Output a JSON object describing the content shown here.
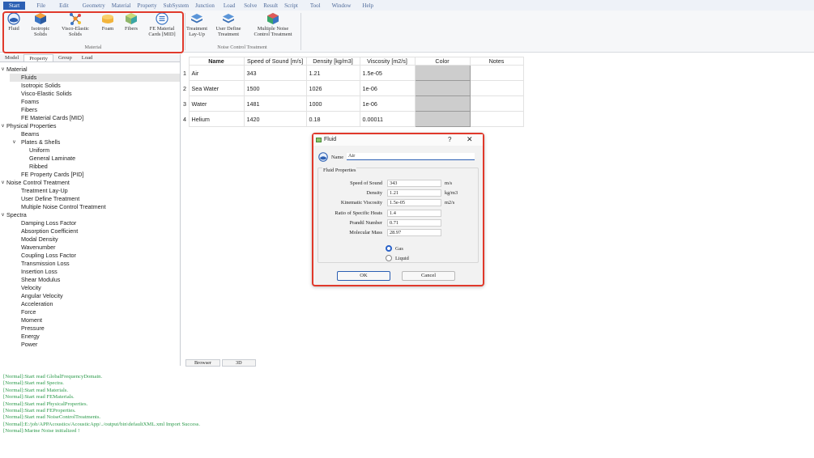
{
  "menu": [
    "Start",
    "File",
    "Edit",
    "Geometry",
    "Material",
    "Property",
    "SubSystem",
    "Junction",
    "Load",
    "Solve",
    "Result",
    "Script",
    "Tool",
    "Window",
    "Help"
  ],
  "ribbon": {
    "material_group": {
      "label": "Material",
      "buttons": [
        {
          "name": "fluid",
          "line1": "Fluid",
          "line2": ""
        },
        {
          "name": "isotropic",
          "line1": "Isotropic",
          "line2": "Solids"
        },
        {
          "name": "visco",
          "line1": "Visco-Elastic",
          "line2": "Solids"
        },
        {
          "name": "foam",
          "line1": "Foam",
          "line2": ""
        },
        {
          "name": "fibers",
          "line1": "Fibers",
          "line2": ""
        },
        {
          "name": "fe",
          "line1": "FE Material",
          "line2": "Cards [MID]"
        }
      ]
    },
    "noise_group": {
      "label": "Noise Control Treatment",
      "buttons": [
        {
          "name": "treatment",
          "line1": "Treatment",
          "line2": "Lay-Up"
        },
        {
          "name": "userdefine",
          "line1": "User Define",
          "line2": "Treatment"
        },
        {
          "name": "multiple",
          "line1": "Multiple Noise",
          "line2": "Control Treatment"
        }
      ]
    }
  },
  "left_tabs": [
    "Model",
    "Property",
    "Group",
    "Load"
  ],
  "tree": [
    {
      "text": "Material",
      "level": 0,
      "exp": "v"
    },
    {
      "text": "Fluids",
      "level": 1,
      "selected": true
    },
    {
      "text": "Isotropic Solids",
      "level": 1
    },
    {
      "text": "Visco-Elastic Solids",
      "level": 1
    },
    {
      "text": "Foams",
      "level": 1
    },
    {
      "text": "Fibers",
      "level": 1
    },
    {
      "text": "FE Material Cards [MID]",
      "level": 1
    },
    {
      "text": "Physical Properties",
      "level": 0,
      "exp": "v"
    },
    {
      "text": "Beams",
      "level": 1
    },
    {
      "text": "Plates & Shells",
      "level": 1,
      "exp": "v"
    },
    {
      "text": "Uniform",
      "level": 2
    },
    {
      "text": "General Laminate",
      "level": 2
    },
    {
      "text": "Ribbed",
      "level": 2
    },
    {
      "text": "FE Property Cards [PID]",
      "level": 1
    },
    {
      "text": "Noise Control Treatment",
      "level": 0,
      "exp": "v"
    },
    {
      "text": "Treatment Lay-Up",
      "level": 1
    },
    {
      "text": "User Define Treatment",
      "level": 1
    },
    {
      "text": "Multiple Noise Control Treatment",
      "level": 1
    },
    {
      "text": "Spectra",
      "level": 0,
      "exp": "v"
    },
    {
      "text": "Damping Loss Factor",
      "level": 1
    },
    {
      "text": "Absorption Coefficient",
      "level": 1
    },
    {
      "text": "Modal Density",
      "level": 1
    },
    {
      "text": "Wavenumber",
      "level": 1
    },
    {
      "text": "Coupling Loss Factor",
      "level": 1
    },
    {
      "text": "Transmission Loss",
      "level": 1
    },
    {
      "text": "Insertion Loss",
      "level": 1
    },
    {
      "text": "Shear Modulus",
      "level": 1
    },
    {
      "text": "Velocity",
      "level": 1
    },
    {
      "text": "Angular Velocity",
      "level": 1
    },
    {
      "text": "Acceleration",
      "level": 1
    },
    {
      "text": "Force",
      "level": 1
    },
    {
      "text": "Moment",
      "level": 1
    },
    {
      "text": "Pressure",
      "level": 1
    },
    {
      "text": "Energy",
      "level": 1
    },
    {
      "text": "Power",
      "level": 1
    }
  ],
  "table": {
    "headers": [
      "Name",
      "Speed of Sound [m/s]",
      "Density [kg/m3]",
      "Viscosity [m2/s]",
      "Color",
      "Notes"
    ],
    "rows": [
      {
        "num": "1",
        "name": "Air",
        "speed": "343",
        "density": "1.21",
        "viscosity": "1.5e-05"
      },
      {
        "num": "2",
        "name": "Sea Water",
        "speed": "1500",
        "density": "1026",
        "viscosity": "1e-06"
      },
      {
        "num": "3",
        "name": "Water",
        "speed": "1481",
        "density": "1000",
        "viscosity": "1e-06"
      },
      {
        "num": "4",
        "name": "Helium",
        "speed": "1420",
        "density": "0.18",
        "viscosity": "0.00011"
      }
    ]
  },
  "bottom_tabs": [
    "Browser",
    "3D"
  ],
  "log": [
    "[Normal]:Start read GlobalFrequencyDomain.",
    "[Normal]:Start read Spectra.",
    "[Normal]:Start read Materials.",
    "[Normal]:Start read FEMaterials.",
    "[Normal]:Start read PhysicalProperties.",
    "[Normal]:Start read FEProperties.",
    "[Normal]:Start read NoiseControlTreatments.",
    "[Normal]:E:/job/APPAcoustics/AcousticApp/../output/bin\\defaultXML.xml Import Success.",
    "[Normal]:Marine Noise initialized !"
  ],
  "dialog": {
    "title": "Fluid",
    "help": "?",
    "close": "✕",
    "name_label": "Name",
    "name_value": "Air",
    "group_title": "Fluid Properties",
    "fields": [
      {
        "label": "Speed of Sound",
        "value": "343",
        "unit": "m/s"
      },
      {
        "label": "Density",
        "value": "1.21",
        "unit": "kg/m3"
      },
      {
        "label": "Kinematic Viscosity",
        "value": "1.5e-05",
        "unit": "m2/s"
      },
      {
        "label": "Ratio of Specific Heats",
        "value": "1.4",
        "unit": ""
      },
      {
        "label": "Prandtl Number",
        "value": "0.71",
        "unit": ""
      },
      {
        "label": "Molecular Mass",
        "value": "28.97",
        "unit": ""
      }
    ],
    "radio_gas": "Gas",
    "radio_liquid": "Liquid",
    "ok": "OK",
    "cancel": "Cancel"
  },
  "colors": {
    "accent": "#2b5fb3",
    "highlight": "#e0392b",
    "log": "#2b9a4a"
  }
}
